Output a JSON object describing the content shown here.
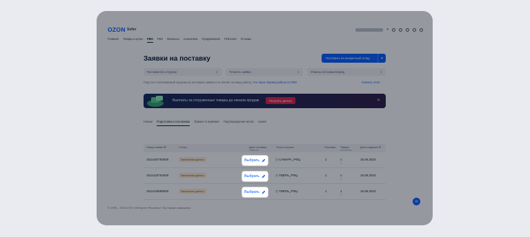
{
  "header": {
    "logo": "OZON",
    "logo_sub": "Seller",
    "nav": [
      "Главная",
      "Товары и цены",
      "FBO",
      "FBS",
      "Финансы",
      "Аналитика",
      "Продвижение",
      "Рейтинги",
      "Отзывы"
    ],
    "active_nav": "FBO"
  },
  "page": {
    "title": "Заявки на поставку",
    "cta_label": "Поставить на конкретный склад",
    "filters": [
      "Поставки без отгрузок",
      "Точность заявки",
      "Отмены поставки вперед"
    ],
    "hint_text": "Подо нет оплачиваемой загрузки на поставках заявки и не влияет на вашу работу.",
    "hint_link": "Что такое Оценка работы по FBO",
    "download": "Скачать отчёт"
  },
  "banner": {
    "text": "Выплаты за отгруженные товары до начала продаж",
    "button": "Получить деньги"
  },
  "tabs": [
    "Новые",
    "Подготовка к поставкам",
    "Тракинг в приёмке",
    "Подтверждение актов",
    "Архив"
  ],
  "active_tab": "Подготовка к поставкам",
  "table": {
    "headers": [
      {
        "label": "Номер заявки",
        "sub": ""
      },
      {
        "label": "Статус",
        "sub": ""
      },
      {
        "label": "Дата поставки",
        "sub": "Таймслот"
      },
      {
        "label": "Точка отгрузки",
        "sub": ""
      },
      {
        "label": "Поставки",
        "sub": ""
      },
      {
        "label": "Товары",
        "sub": "количество"
      },
      {
        "label": "Дата создания",
        "sub": ""
      }
    ],
    "rows": [
      {
        "id": "1511420783000",
        "status": "Заполнение данных",
        "select": "Выбрать",
        "warehouse": "САМАРА_РФЦ",
        "supplies": "1",
        "goods": "1",
        "goods_sub": "1",
        "created": "15.06.2023"
      },
      {
        "id": "1511418754000",
        "status": "Заполнение данных",
        "select": "Выбрать",
        "warehouse": "ТВЕРЬ_РФЦ",
        "supplies": "1",
        "goods": "1",
        "goods_sub": "1",
        "created": "15.06.2023"
      },
      {
        "id": "1511418689000",
        "status": "Заполнение данных",
        "select": "Выбрать",
        "warehouse": "ТВЕРЬ_РФЦ",
        "supplies": "1",
        "goods": "1",
        "goods_sub": "1",
        "created": "15.06.2023"
      }
    ]
  },
  "footer": "© 1998 – 2023 ООО «Интернет Решения». Все права защищены.",
  "colors": {
    "brand": "#005bff",
    "banner_button": "#e01f45",
    "badge": "#fde9cf"
  }
}
